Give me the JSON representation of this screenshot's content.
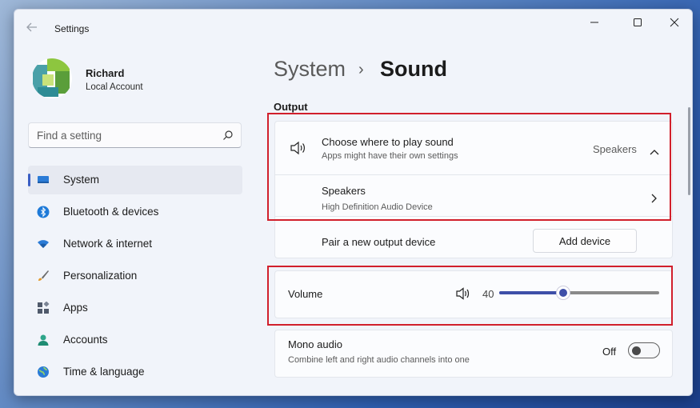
{
  "window": {
    "title": "Settings",
    "controls": {
      "minimize": "minimize-icon",
      "maximize": "maximize-icon",
      "close": "close-icon"
    }
  },
  "profile": {
    "name": "Richard",
    "account_type": "Local Account"
  },
  "search": {
    "placeholder": "Find a setting",
    "icon": "search-icon"
  },
  "sidebar": {
    "items": [
      {
        "label": "System",
        "icon": "monitor-icon",
        "active": true
      },
      {
        "label": "Bluetooth & devices",
        "icon": "bluetooth-icon"
      },
      {
        "label": "Network & internet",
        "icon": "wifi-icon"
      },
      {
        "label": "Personalization",
        "icon": "brush-icon"
      },
      {
        "label": "Apps",
        "icon": "apps-icon"
      },
      {
        "label": "Accounts",
        "icon": "person-icon"
      },
      {
        "label": "Time & language",
        "icon": "globe-icon"
      }
    ]
  },
  "main": {
    "breadcrumb": {
      "parent": "System",
      "separator": "›",
      "current": "Sound"
    },
    "output_section": "Output",
    "choose_output": {
      "title": "Choose where to play sound",
      "subtitle": "Apps might have their own settings",
      "value": "Speakers",
      "expanded": true
    },
    "speakers": {
      "title": "Speakers",
      "subtitle": "High Definition Audio Device"
    },
    "pair_device": {
      "title": "Pair a new output device",
      "button": "Add device"
    },
    "volume": {
      "label": "Volume",
      "value": "40",
      "level": 0.4
    },
    "mono_audio": {
      "title": "Mono audio",
      "subtitle": "Combine left and right audio channels into one",
      "state": "Off"
    }
  },
  "colors": {
    "accent": "#3e4fa8",
    "highlight": "#d11f2b"
  }
}
